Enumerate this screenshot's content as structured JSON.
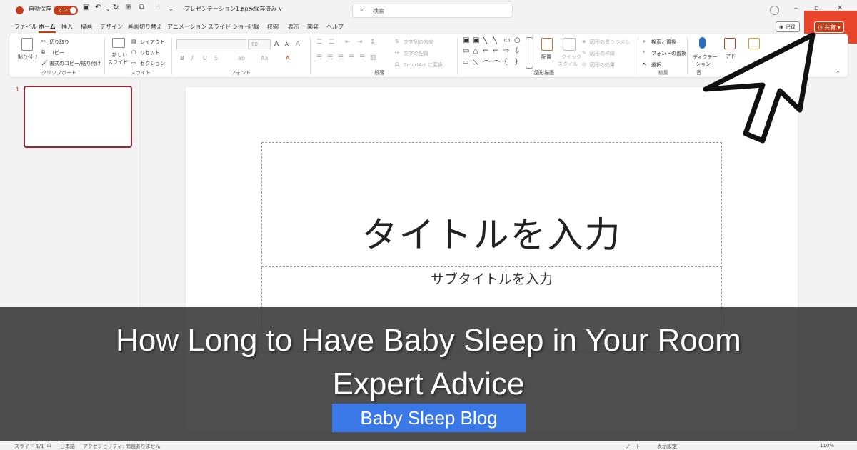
{
  "titlebar": {
    "autosave_label": "自動保存",
    "autosave_state": "オン",
    "filename": "プレゼンテーション1.pptx",
    "save_status": "• 保存済み ∨",
    "search_placeholder": "検索",
    "minimize": "–",
    "maximize": "▫",
    "close": "✕"
  },
  "menu_tabs": [
    "ファイル",
    "ホーム",
    "挿入",
    "描画",
    "デザイン",
    "画面切り替え",
    "アニメーション",
    "スライド ショー",
    "記録",
    "校閲",
    "表示",
    "開発",
    "ヘルプ"
  ],
  "right_buttons": {
    "record": "◉ 記録",
    "share": "⊡ 共有 ▾"
  },
  "ribbon": {
    "clipboard": {
      "paste": "貼り付け",
      "cut": "切り取り",
      "copy": "コピー",
      "format_painter": "書式のコピー/貼り付け",
      "group": "クリップボード"
    },
    "slides": {
      "new_slide": "新しい",
      "new_slide2": "スライド",
      "layout": "レイアウト",
      "reset": "リセット",
      "section": "セクション",
      "group": "スライド"
    },
    "font": {
      "size": "60",
      "group": "フォント",
      "bold": "B",
      "italic": "I",
      "underline": "U",
      "strike": "S",
      "spacing": "ab",
      "case": "Aa",
      "color": "A",
      "grow": "A",
      "shrink": "A",
      "clear": "A"
    },
    "paragraph": {
      "text_direction": "文字列の方向",
      "align_text": "文字の配置",
      "smartart": "SmartArt に変換",
      "group": "段落"
    },
    "drawing": {
      "arrange": "配置",
      "quick_styles": "クイック",
      "quick_styles2": "スタイル",
      "fill": "図形の塗りつぶし",
      "outline": "図形の枠線",
      "effects": "図形の効果",
      "group": "図形描画"
    },
    "editing": {
      "find": "検索と置換",
      "replace": "フォントの置換",
      "select": "選択",
      "group": "編集"
    },
    "voice": {
      "dictate": "ディクテー",
      "dictate2": "ション",
      "group": "音"
    },
    "addins": {
      "label": "アド"
    }
  },
  "slide_panel": {
    "number": "1"
  },
  "slide": {
    "title_placeholder": "タイトルを入力",
    "subtitle_placeholder": "サブタイトルを入力"
  },
  "status_bar": {
    "slide_info": "スライド 1/1",
    "language": "日本語",
    "accessibility": "アクセシビリティ: 問題ありません",
    "notes": "ノート",
    "display_settings": "表示設定",
    "zoom": "110%"
  },
  "overlay": {
    "title_line1": "How Long to Have Baby Sleep in Your Room",
    "title_line2": "Expert Advice",
    "badge": "  Baby Sleep Blog"
  },
  "colors": {
    "accent": "#c43e1c",
    "highlight": "#e8452c",
    "badge": "#3a78e8"
  }
}
